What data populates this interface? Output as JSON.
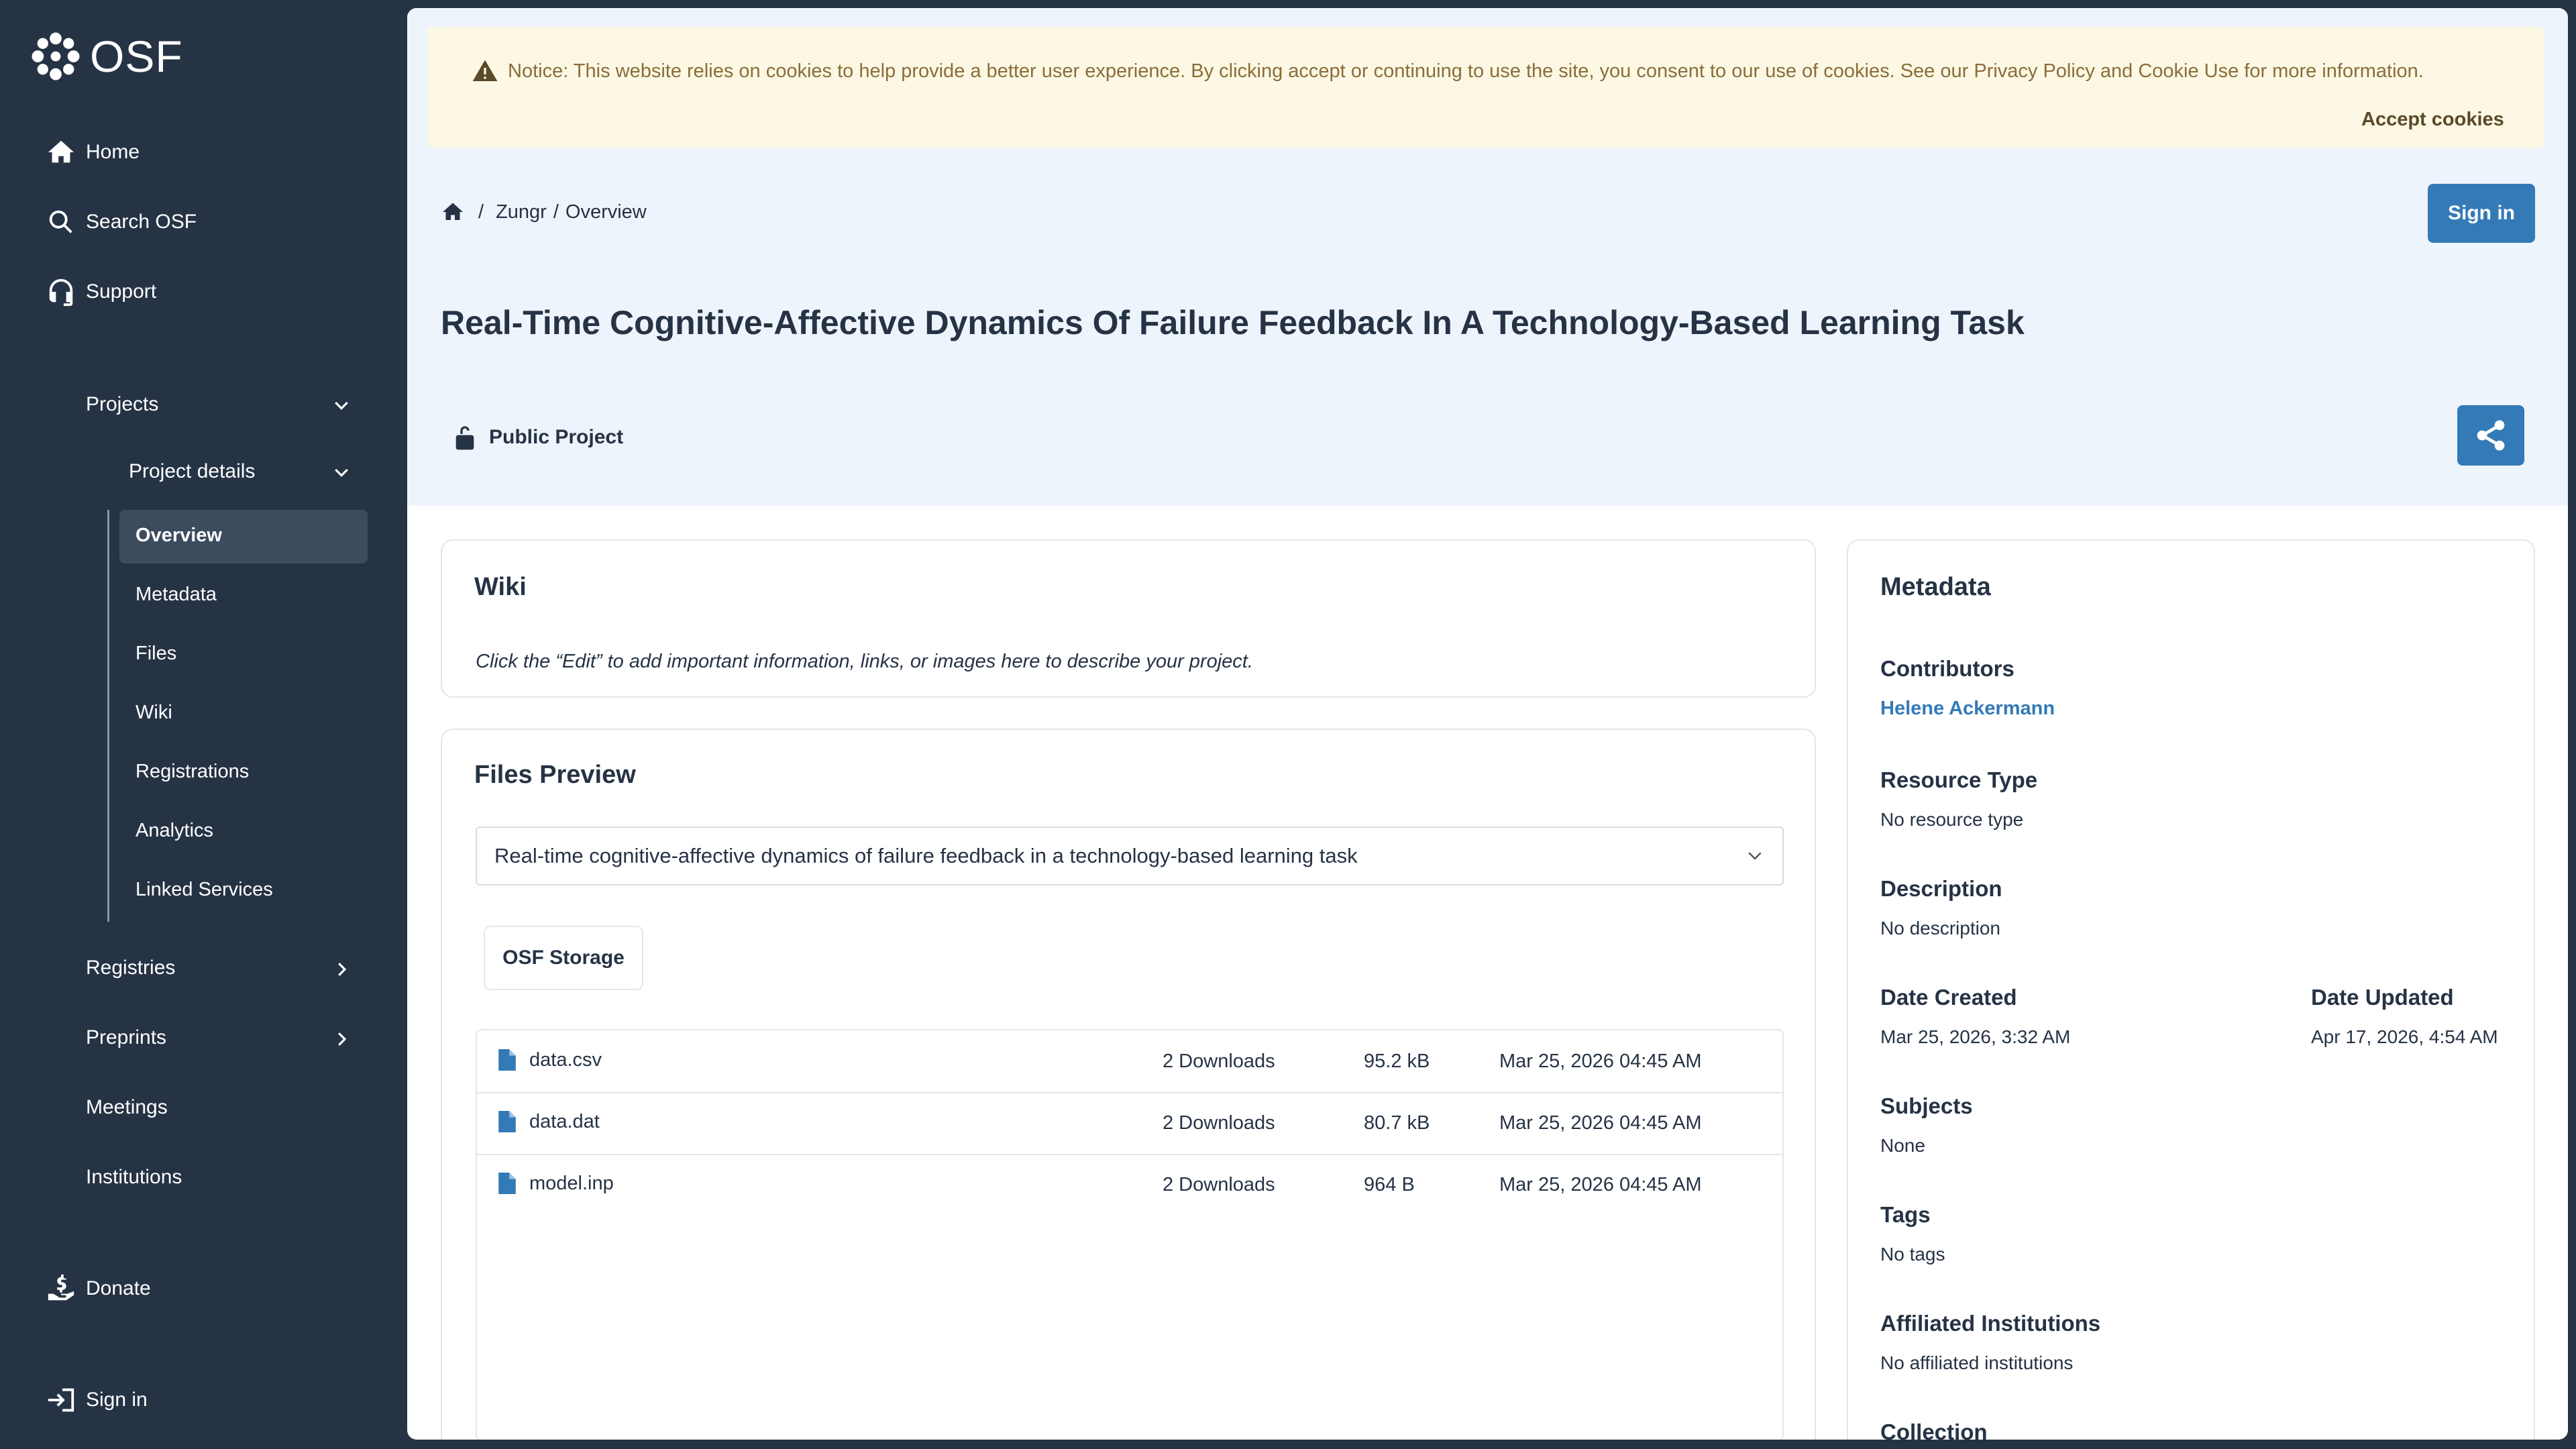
{
  "brand": {
    "name": "OSF"
  },
  "sidebar": {
    "home": "Home",
    "search": "Search OSF",
    "support": "Support",
    "projects": "Projects",
    "project_details": "Project details",
    "sub_items": [
      "Overview",
      "Metadata",
      "Files",
      "Wiki",
      "Registrations",
      "Analytics",
      "Linked Services"
    ],
    "registries": "Registries",
    "preprints": "Preprints",
    "meetings": "Meetings",
    "institutions": "Institutions",
    "donate": "Donate",
    "sign_in": "Sign in"
  },
  "notice": {
    "text": "Notice: This website relies on cookies to help provide a better user experience. By clicking accept or continuing to use the site, you consent to our use of cookies. See our Privacy Policy and Cookie Use for more information.",
    "accept": "Accept cookies"
  },
  "breadcrumb": {
    "separator": "/",
    "project": "Zungr",
    "page": "Overview",
    "sep2": "/"
  },
  "header": {
    "sign_in": "Sign in"
  },
  "project": {
    "title": "Real-Time Cognitive-Affective Dynamics Of Failure Feedback In A Technology-Based Learning Task",
    "visibility": "Public Project"
  },
  "wiki": {
    "heading": "Wiki",
    "placeholder": "Click the “Edit” to add important information, links, or images here to describe your project."
  },
  "files": {
    "heading": "Files Preview",
    "selected_project": "Real-time cognitive-affective dynamics of failure feedback in a technology-based learning task",
    "storage": "OSF Storage",
    "rows": [
      {
        "name": "data.csv",
        "downloads": "2 Downloads",
        "size": "95.2 kB",
        "date": "Mar 25, 2026 04:45 AM"
      },
      {
        "name": "data.dat",
        "downloads": "2 Downloads",
        "size": "80.7 kB",
        "date": "Mar 25, 2026 04:45 AM"
      },
      {
        "name": "model.inp",
        "downloads": "2 Downloads",
        "size": "964 B",
        "date": "Mar 25, 2026 04:45 AM"
      }
    ]
  },
  "metadata": {
    "heading": "Metadata",
    "contributors_label": "Contributors",
    "contributor": "Helene Ackermann",
    "resource_type_label": "Resource Type",
    "resource_type": "No resource type",
    "description_label": "Description",
    "description": "No description",
    "date_created_label": "Date Created",
    "date_created": "Mar 25, 2026, 3:32 AM",
    "date_updated_label": "Date Updated",
    "date_updated": "Apr 17, 2026, 4:54 AM",
    "subjects_label": "Subjects",
    "subjects": "None",
    "tags_label": "Tags",
    "tags": "No tags",
    "affiliated_label": "Affiliated Institutions",
    "affiliated": "No affiliated institutions",
    "collection_label": "Collection"
  },
  "colors": {
    "sidebar": "#263345",
    "accent": "#337ab7",
    "notice_bg": "#fcf8e3",
    "hero_bg": "#eef4fb"
  }
}
